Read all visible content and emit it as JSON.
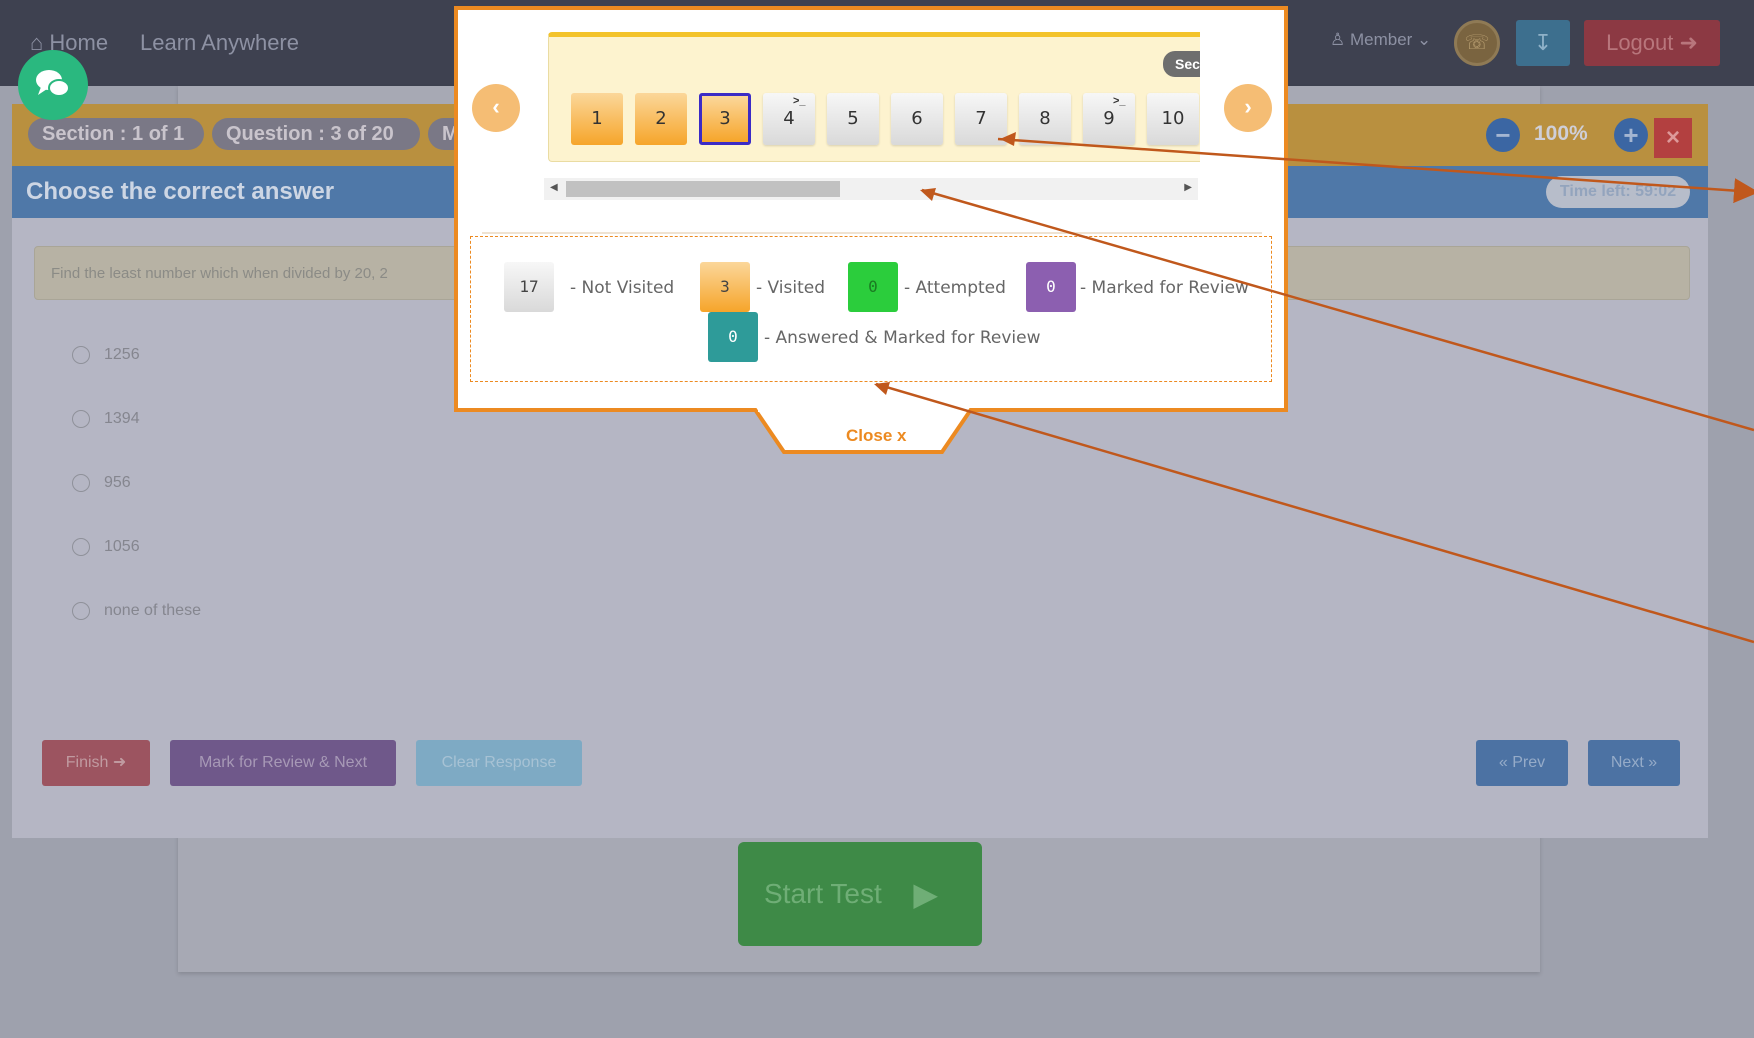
{
  "nav": {
    "home": "⌂ Home",
    "learn": "Learn Anywhere",
    "member": "♙ Member ⌄",
    "logout": "Logout ➜"
  },
  "exam": {
    "section": "Section : 1 of 1",
    "question": "Question : 3 of 20",
    "marks_chip": "M",
    "zoom": "100%",
    "title": "Choose the correct answer",
    "timer": "Time left: 59:02",
    "question_text": "Find the least number which when divided by 20, 2",
    "options": [
      "1256",
      "1394",
      "956",
      "1056",
      "none of these"
    ],
    "buttons": {
      "finish": "Finish ➜",
      "mark_review": "Mark for Review & Next",
      "clear": "Clear Response",
      "prev": "« Prev",
      "next": "Next »"
    },
    "start_test": "Start Test"
  },
  "popup": {
    "section_chip": "Sec",
    "questions": [
      {
        "n": "1",
        "state": "visited",
        "flag": ""
      },
      {
        "n": "2",
        "state": "visited",
        "flag": ""
      },
      {
        "n": "3",
        "state": "current",
        "flag": ""
      },
      {
        "n": "4",
        "state": "not-visited",
        "flag": ">_"
      },
      {
        "n": "5",
        "state": "not-visited",
        "flag": ""
      },
      {
        "n": "6",
        "state": "not-visited",
        "flag": ""
      },
      {
        "n": "7",
        "state": "not-visited",
        "flag": ""
      },
      {
        "n": "8",
        "state": "not-visited",
        "flag": ""
      },
      {
        "n": "9",
        "state": "not-visited",
        "flag": ">_"
      },
      {
        "n": "10",
        "state": "not-visited",
        "flag": ""
      }
    ],
    "legend": {
      "not_visited_count": "17",
      "not_visited_label": "- Not Visited",
      "visited_count": "3",
      "visited_label": "- Visited",
      "attempted_count": "0",
      "attempted_label": "- Attempted",
      "review_count": "0",
      "review_label": "- Marked for Review",
      "answered_review_count": "0",
      "answered_review_label": "- Answered & Marked for Review"
    },
    "close": "Close x",
    "prev_arrow": "‹",
    "next_arrow": "›"
  },
  "colors": {
    "accent_orange": "#ec8a21",
    "visited": "#f6a52a",
    "attempted": "#2bcd3c",
    "marked_review": "#8c5fb0",
    "answered_review": "#2e9b99",
    "annotation_arrow": "#c0581c"
  }
}
